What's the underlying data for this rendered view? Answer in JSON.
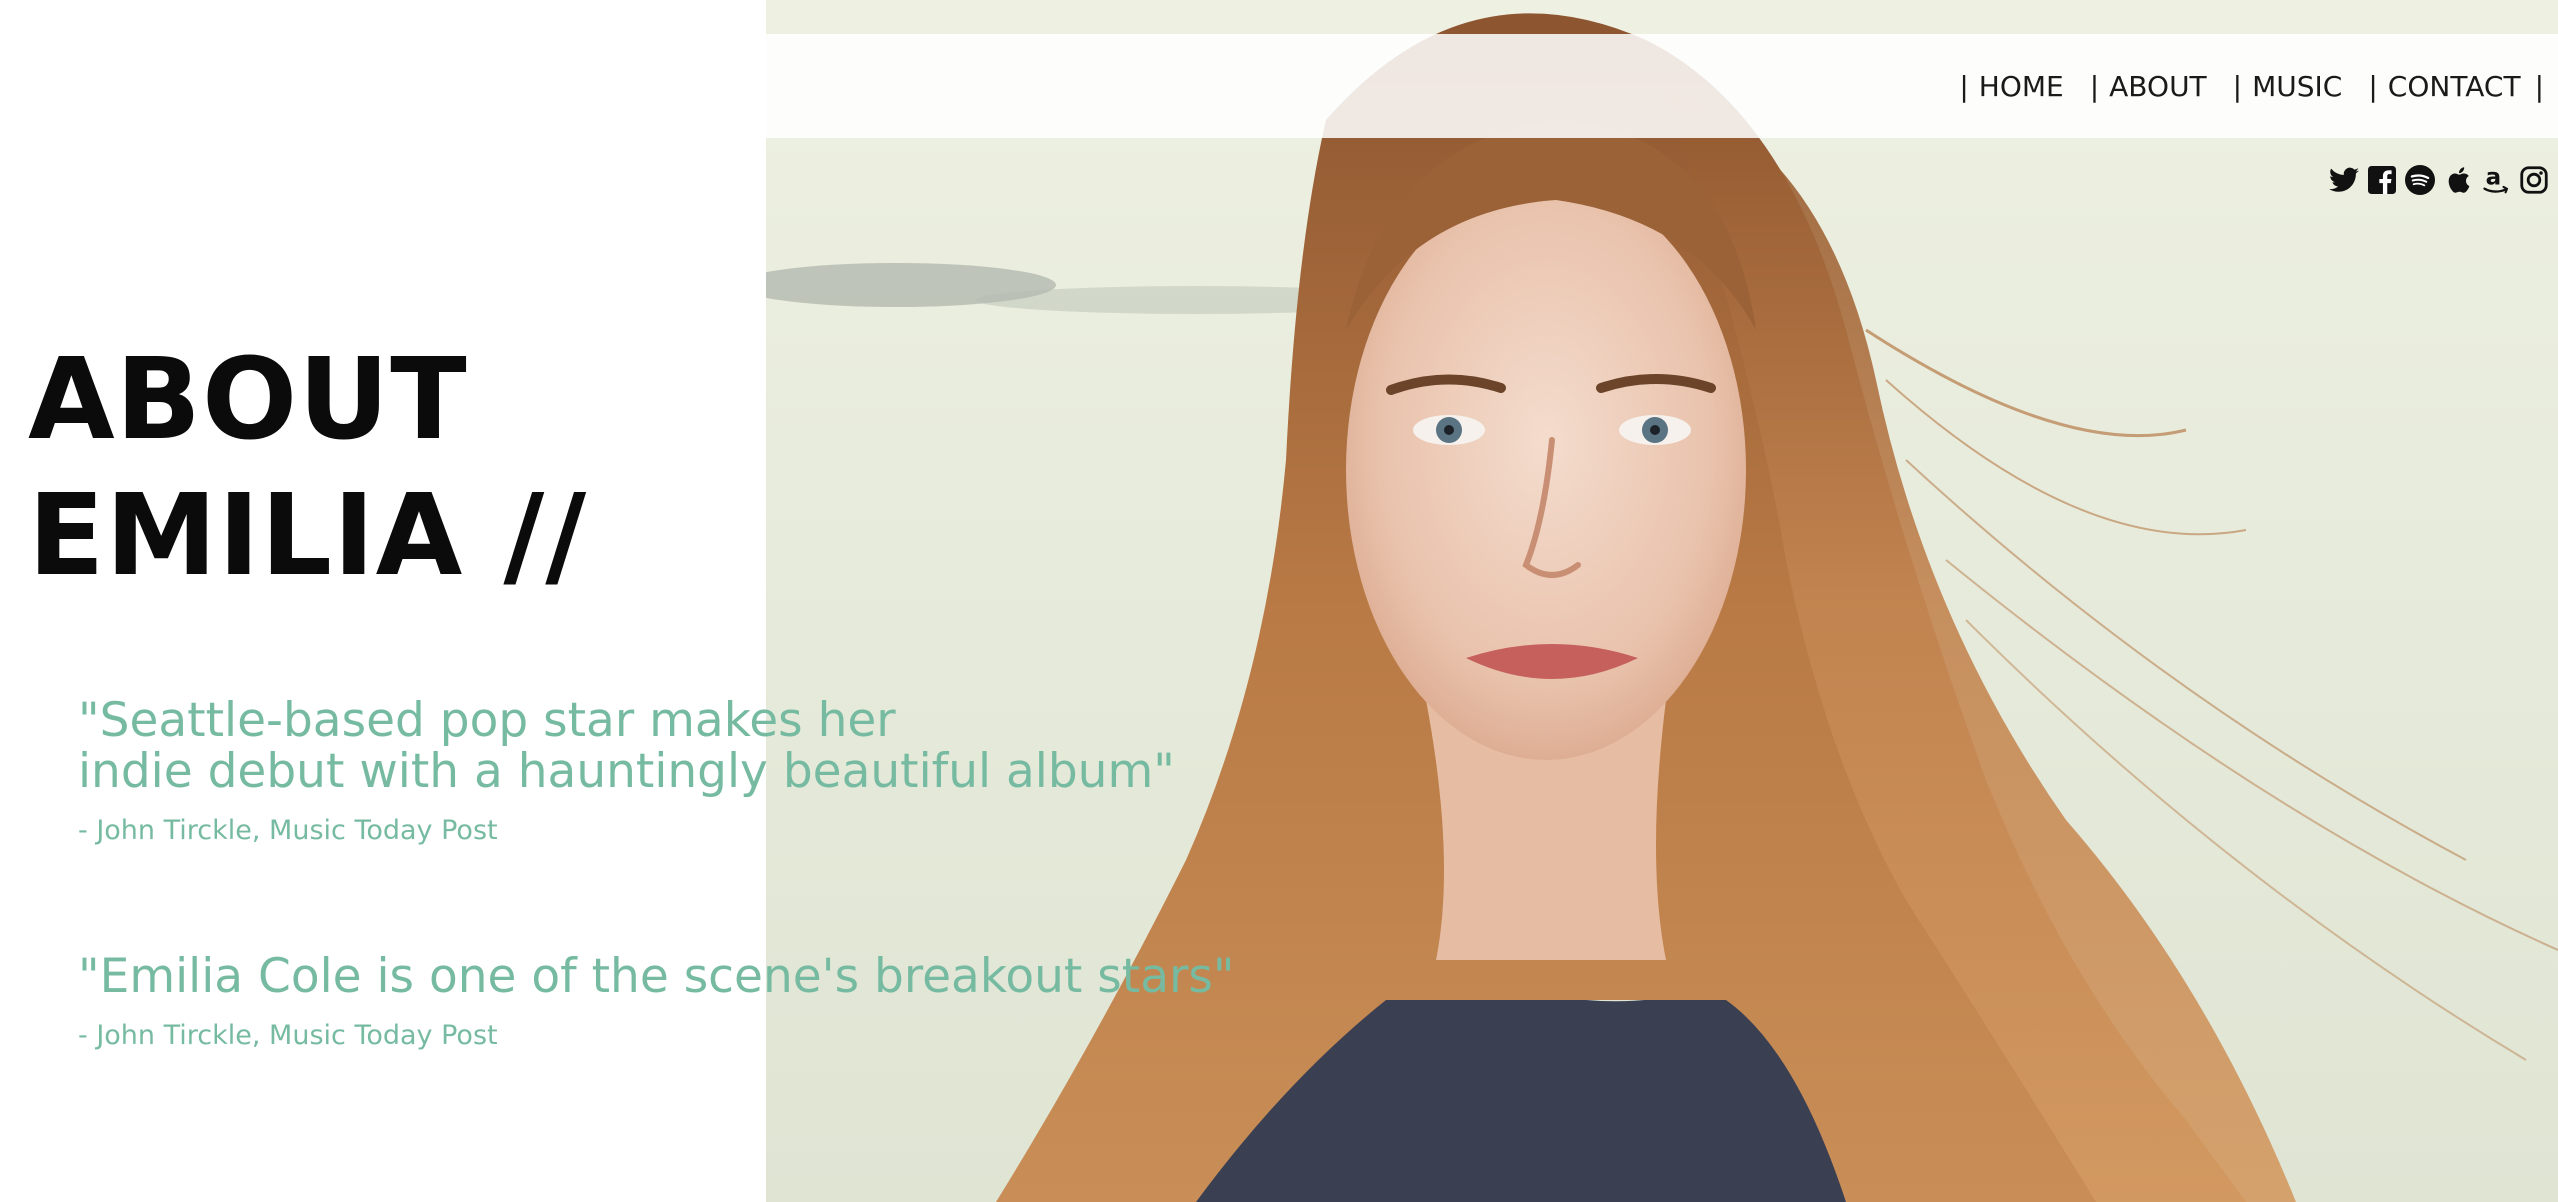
{
  "nav": {
    "items": [
      {
        "label": "HOME"
      },
      {
        "label": "ABOUT"
      },
      {
        "label": "MUSIC"
      },
      {
        "label": "CONTACT"
      }
    ],
    "separator": "|"
  },
  "social": {
    "icons": [
      "twitter-icon",
      "facebook-icon",
      "spotify-icon",
      "apple-icon",
      "amazon-icon",
      "instagram-icon"
    ]
  },
  "page": {
    "title_line1": "ABOUT",
    "title_line2": "EMILIA //"
  },
  "quotes": [
    {
      "line1": "\"Seattle-based pop star makes her",
      "line2": "indie debut with a hauntingly beautiful album\"",
      "source": "- John Tirckle, Music Today Post"
    },
    {
      "line1": "\"Emilia Cole is one of the scene's breakout stars\"",
      "source": "- John Tirckle, Music Today Post"
    }
  ],
  "colors": {
    "quote": "#76bba1",
    "title": "#0b0b0b",
    "nav_text": "#1a1a1a",
    "hair": "#b0703e"
  }
}
